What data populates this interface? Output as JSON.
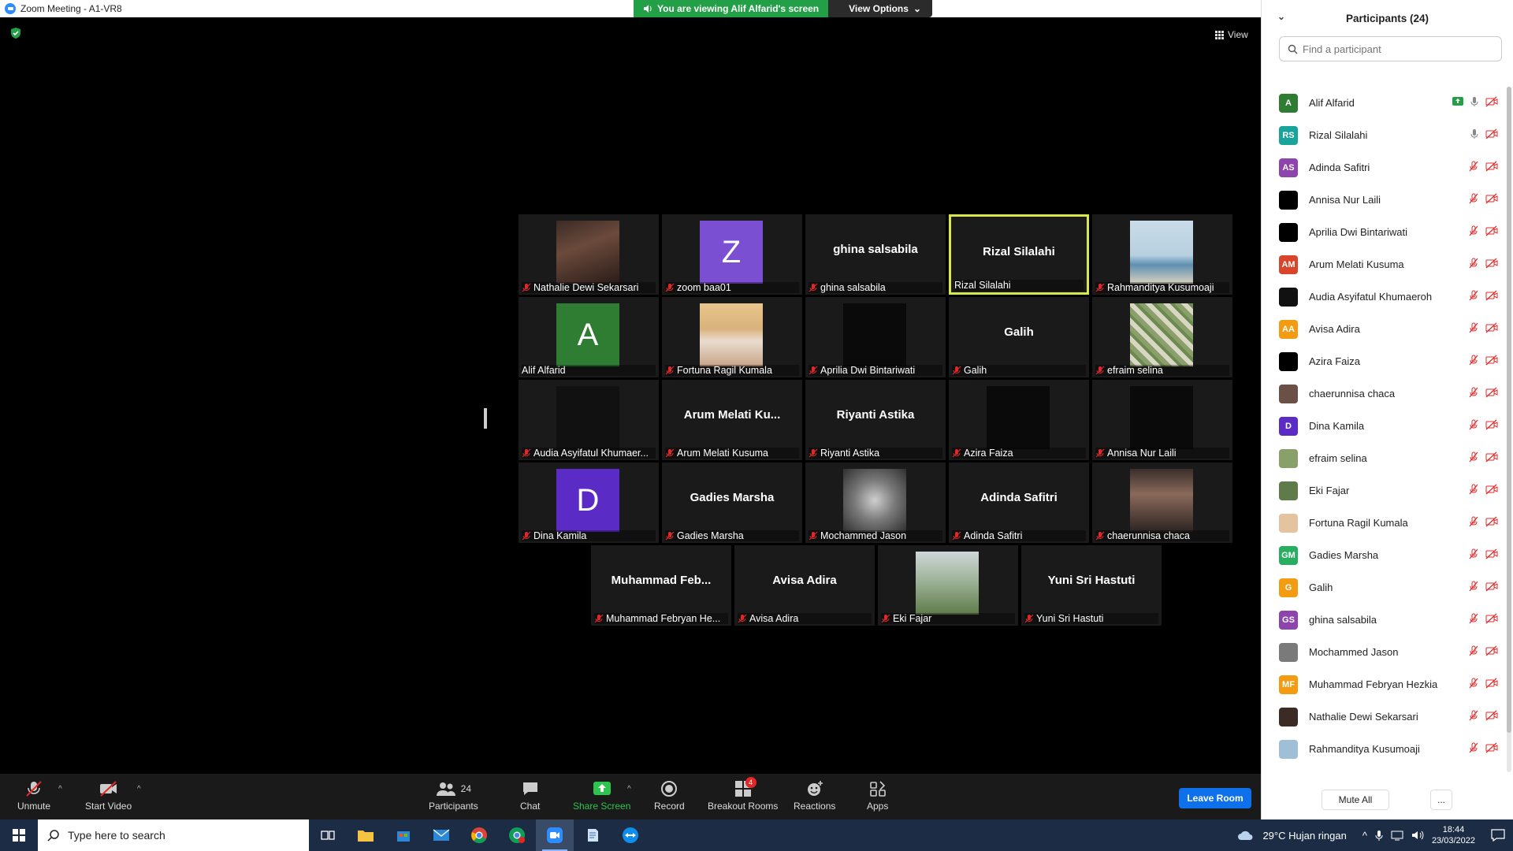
{
  "window": {
    "title": "Zoom Meeting - A1-VR8",
    "controls": [
      "–",
      "❐",
      "✕"
    ]
  },
  "share_banner": {
    "text": "You are viewing Alif Alfarid's screen",
    "view_options": "View Options"
  },
  "view_button": "View",
  "tiles": [
    {
      "name": "Nathalie Dewi Sekarsari",
      "big": "",
      "kind": "photo-portrait",
      "muted": true,
      "active": false
    },
    {
      "name": "zoom baa01",
      "big": "",
      "kind": "letter",
      "letter": "Z",
      "color": "#7b4fd1",
      "muted": true,
      "active": false
    },
    {
      "name": "ghina salsabila",
      "big": "ghina salsabila",
      "kind": "text",
      "muted": true,
      "active": false
    },
    {
      "name": "Rizal Silalahi",
      "big": "Rizal Silalahi",
      "kind": "text",
      "muted": false,
      "active": true
    },
    {
      "name": "Rahmanditya Kusumoaji",
      "big": "",
      "kind": "photo-sea",
      "muted": true,
      "active": false
    },
    {
      "name": "Alif Alfarid",
      "big": "",
      "kind": "letter",
      "letter": "A",
      "color": "#2e7d32",
      "muted": false,
      "active": false
    },
    {
      "name": "Fortuna Ragil Kumala",
      "big": "",
      "kind": "photo-hijab",
      "muted": true,
      "active": false
    },
    {
      "name": "Aprilia Dwi Bintariwati",
      "big": "",
      "kind": "black",
      "muted": true,
      "active": false
    },
    {
      "name": "Galih",
      "big": "Galih",
      "kind": "text",
      "muted": true,
      "active": false
    },
    {
      "name": "efraim selina",
      "big": "",
      "kind": "photo-vines",
      "muted": true,
      "active": false
    },
    {
      "name": "Audia Asyifatul Khumaer...",
      "big": "",
      "kind": "photo-text",
      "muted": true,
      "active": false
    },
    {
      "name": "Arum Melati Kusuma",
      "big": "Arum  Melati  Ku...",
      "kind": "text",
      "muted": true,
      "active": false
    },
    {
      "name": "Riyanti Astika",
      "big": "Riyanti Astika",
      "kind": "text",
      "muted": true,
      "active": false
    },
    {
      "name": "Azira Faiza",
      "big": "",
      "kind": "black",
      "muted": true,
      "active": false
    },
    {
      "name": "Annisa Nur Laili",
      "big": "",
      "kind": "black",
      "muted": true,
      "active": false
    },
    {
      "name": "Dina Kamila",
      "big": "",
      "kind": "letter",
      "letter": "D",
      "color": "#5b2bc6",
      "muted": true,
      "active": false
    },
    {
      "name": "Gadies Marsha",
      "big": "Gadies Marsha",
      "kind": "text",
      "muted": true,
      "active": false
    },
    {
      "name": "Mochammed Jason",
      "big": "",
      "kind": "photo-mirror",
      "muted": true,
      "active": false
    },
    {
      "name": "Adinda Safitri",
      "big": "Adinda Safitri",
      "kind": "text",
      "muted": true,
      "active": false
    },
    {
      "name": "chaerunnisa chaca",
      "big": "",
      "kind": "photo-church",
      "muted": true,
      "active": false
    },
    {
      "name": "Muhammad Febryan He...",
      "big": "Muhammad  Feb...",
      "kind": "text",
      "muted": true,
      "active": false
    },
    {
      "name": "Avisa Adira",
      "big": "Avisa Adira",
      "kind": "text",
      "muted": true,
      "active": false
    },
    {
      "name": "Eki Fajar",
      "big": "",
      "kind": "photo-field",
      "muted": true,
      "active": false
    },
    {
      "name": "Yuni Sri Hastuti",
      "big": "Yuni Sri Hastuti",
      "kind": "text",
      "muted": true,
      "active": false
    }
  ],
  "toolbar": {
    "unmute": "Unmute",
    "start_video": "Start Video",
    "participants": "Participants",
    "participants_count": "24",
    "chat": "Chat",
    "share_screen": "Share Screen",
    "record": "Record",
    "breakout_rooms": "Breakout Rooms",
    "breakout_badge": "4",
    "reactions": "Reactions",
    "apps": "Apps",
    "leave": "Leave Room"
  },
  "panel": {
    "title": "Participants (24)",
    "search_placeholder": "Find a participant",
    "mute_all": "Mute All",
    "more": "...",
    "participants": [
      {
        "name": "Alif Alfarid",
        "initials": "A",
        "color": "#2e7d32",
        "sharing": true,
        "mic": "on"
      },
      {
        "name": "Rizal Silalahi",
        "initials": "RS",
        "color": "#1aa39a",
        "sharing": false,
        "mic": "on"
      },
      {
        "name": "Adinda Safitri",
        "initials": "AS",
        "color": "#8e44ad",
        "sharing": false,
        "mic": "muted"
      },
      {
        "name": "Annisa Nur Laili",
        "initials": "",
        "color": "#000000",
        "sharing": false,
        "mic": "muted"
      },
      {
        "name": "Aprilia Dwi Bintariwati",
        "initials": "",
        "color": "#000000",
        "sharing": false,
        "mic": "muted"
      },
      {
        "name": "Arum Melati Kusuma",
        "initials": "AM",
        "color": "#d9452b",
        "sharing": false,
        "mic": "muted"
      },
      {
        "name": "Audia Asyifatul Khumaeroh",
        "initials": "",
        "color": "#111111",
        "sharing": false,
        "mic": "muted"
      },
      {
        "name": "Avisa Adira",
        "initials": "AA",
        "color": "#f39c12",
        "sharing": false,
        "mic": "muted"
      },
      {
        "name": "Azira Faiza",
        "initials": "",
        "color": "#000000",
        "sharing": false,
        "mic": "muted"
      },
      {
        "name": "chaerunnisa chaca",
        "initials": "",
        "color": "#6b5048",
        "sharing": false,
        "mic": "muted"
      },
      {
        "name": "Dina Kamila",
        "initials": "D",
        "color": "#5b2bc6",
        "sharing": false,
        "mic": "muted"
      },
      {
        "name": "efraim selina",
        "initials": "",
        "color": "#8aa06a",
        "sharing": false,
        "mic": "muted"
      },
      {
        "name": "Eki Fajar",
        "initials": "",
        "color": "#5f7b4a",
        "sharing": false,
        "mic": "muted"
      },
      {
        "name": "Fortuna Ragil Kumala",
        "initials": "",
        "color": "#e3c3a0",
        "sharing": false,
        "mic": "muted"
      },
      {
        "name": "Gadies Marsha",
        "initials": "GM",
        "color": "#27ae60",
        "sharing": false,
        "mic": "muted"
      },
      {
        "name": "Galih",
        "initials": "G",
        "color": "#f39c12",
        "sharing": false,
        "mic": "muted"
      },
      {
        "name": "ghina salsabila",
        "initials": "GS",
        "color": "#8e44ad",
        "sharing": false,
        "mic": "muted"
      },
      {
        "name": "Mochammed Jason",
        "initials": "",
        "color": "#7a7a7a",
        "sharing": false,
        "mic": "muted"
      },
      {
        "name": "Muhammad Febryan Hezkia",
        "initials": "MF",
        "color": "#f39c12",
        "sharing": false,
        "mic": "muted"
      },
      {
        "name": "Nathalie Dewi Sekarsari",
        "initials": "",
        "color": "#3b2b25",
        "sharing": false,
        "mic": "muted"
      },
      {
        "name": "Rahmanditya Kusumoaji",
        "initials": "",
        "color": "#9fbfd6",
        "sharing": false,
        "mic": "muted"
      }
    ]
  },
  "taskbar": {
    "search_placeholder": "Type here to search",
    "weather": "29°C  Hujan ringan",
    "time": "18:44",
    "date": "23/03/2022"
  },
  "colors": {
    "accent_blue": "#0e71eb",
    "share_green": "#23a047",
    "active_speaker": "#d8e84a",
    "muted_red": "#e02828"
  }
}
